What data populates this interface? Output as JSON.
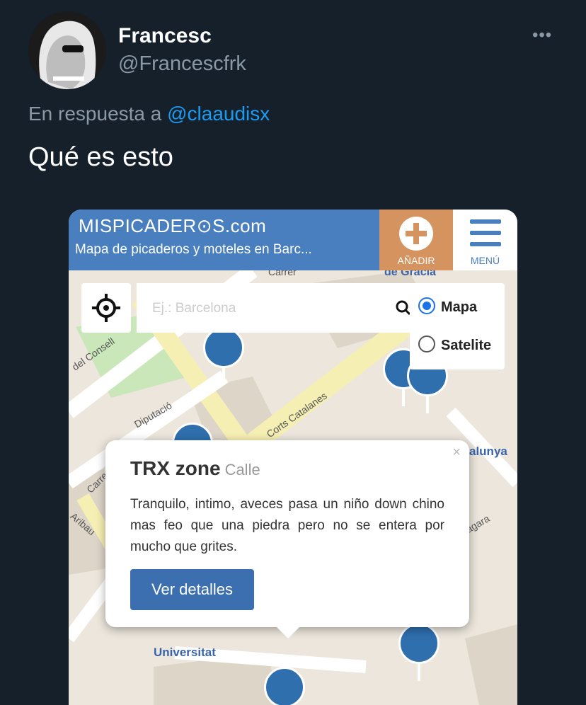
{
  "tweet": {
    "display_name": "Francesc",
    "handle": "@Francescfrk",
    "more_icon": "more-horizontal-icon",
    "reply_prefix": "En respuesta a",
    "reply_mention": "@claaudisx",
    "text": "Qué es esto"
  },
  "site": {
    "title": "MISPICADER⊙S.com",
    "subtitle": "Mapa de picaderos y moteles en Barc...",
    "add_label": "AÑADIR",
    "menu_label": "MENÚ",
    "search_placeholder": "Ej.: Barcelona",
    "layer_options": [
      "Mapa",
      "Satelite"
    ],
    "layer_selected": "Mapa",
    "colors": {
      "header": "#4a7fbf",
      "add_button": "#d4935f",
      "pin": "#2f6fae"
    }
  },
  "map_labels": [
    "Carrer",
    "de Gràcia",
    "del Consell",
    "Corts Catalanes",
    "Diputació",
    "Carrer",
    "Aribau",
    "alunya",
    "Universitat",
    "agara"
  ],
  "popup": {
    "title": "TRX zone",
    "type": "Calle",
    "description": "Tranquilo, intimo, aveces pasa un niño down chino mas feo que una piedra pero no se entera por mucho que grites.",
    "button": "Ver detalles",
    "close": "×"
  }
}
